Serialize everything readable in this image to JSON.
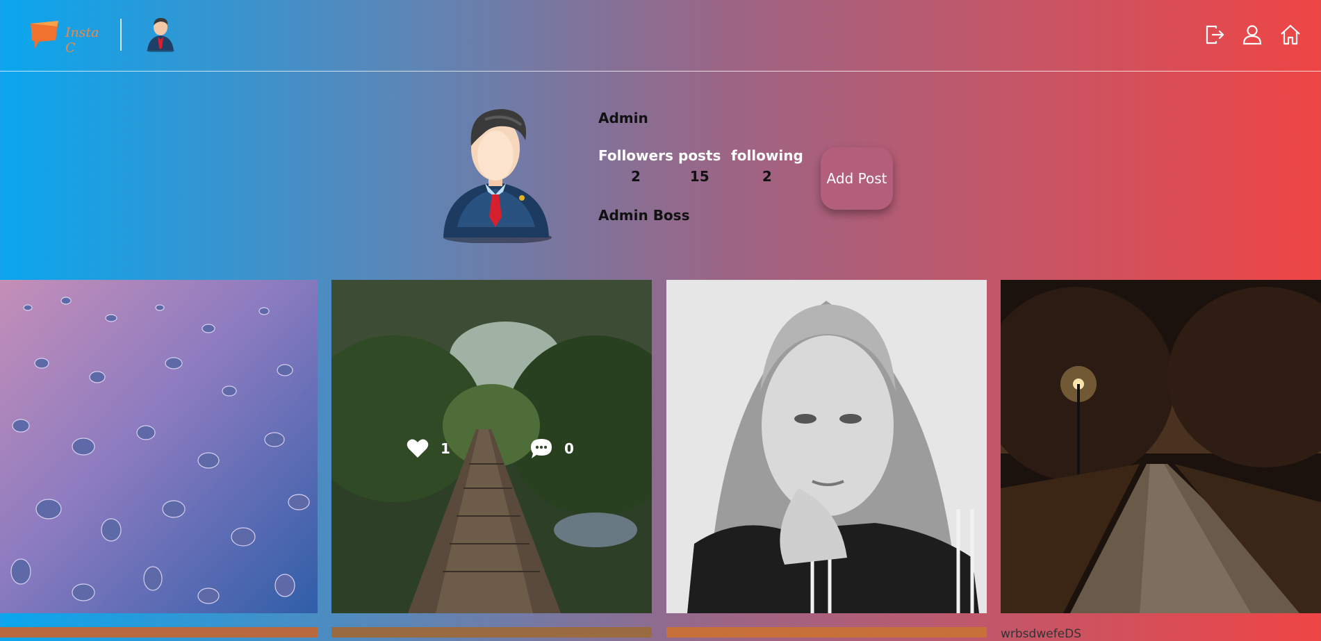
{
  "header": {
    "logo_text": "Insta C",
    "nav": [
      {
        "icon": "logout-icon"
      },
      {
        "icon": "user-icon"
      },
      {
        "icon": "home-icon"
      }
    ]
  },
  "profile": {
    "username": "Admin",
    "stats": [
      {
        "label": "Followers",
        "value": "2"
      },
      {
        "label": "posts",
        "value": "15"
      },
      {
        "label": "following",
        "value": "2"
      }
    ],
    "bio": "Admin Boss",
    "add_post_label": "Add Post"
  },
  "posts": [
    {
      "image": "water-drops"
    },
    {
      "image": "forest-bridge",
      "likes": "1",
      "comments": "0"
    },
    {
      "image": "portrait"
    },
    {
      "image": "night-street"
    }
  ],
  "broken_image_alt": "wrbsdwefeDS"
}
